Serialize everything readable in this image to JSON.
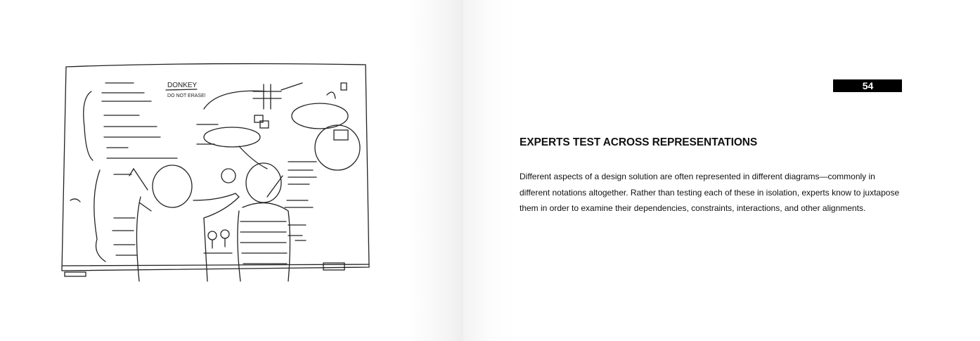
{
  "page": {
    "number": "54",
    "heading": "EXPERTS TEST ACROSS REPRESENTATIONS",
    "body": "Different aspects of a design solution are often represented in different diagrams—commonly in different notations altogether. Rather than testing each of these in isolation, experts know to juxtapose them in order to examine their dependencies, constraints, interactions, and other alignments."
  },
  "illustration": {
    "subject": "two people sketching diagrams on a whiteboard",
    "board_text": [
      "DONKEY",
      "DO NOT ERASE!"
    ]
  }
}
